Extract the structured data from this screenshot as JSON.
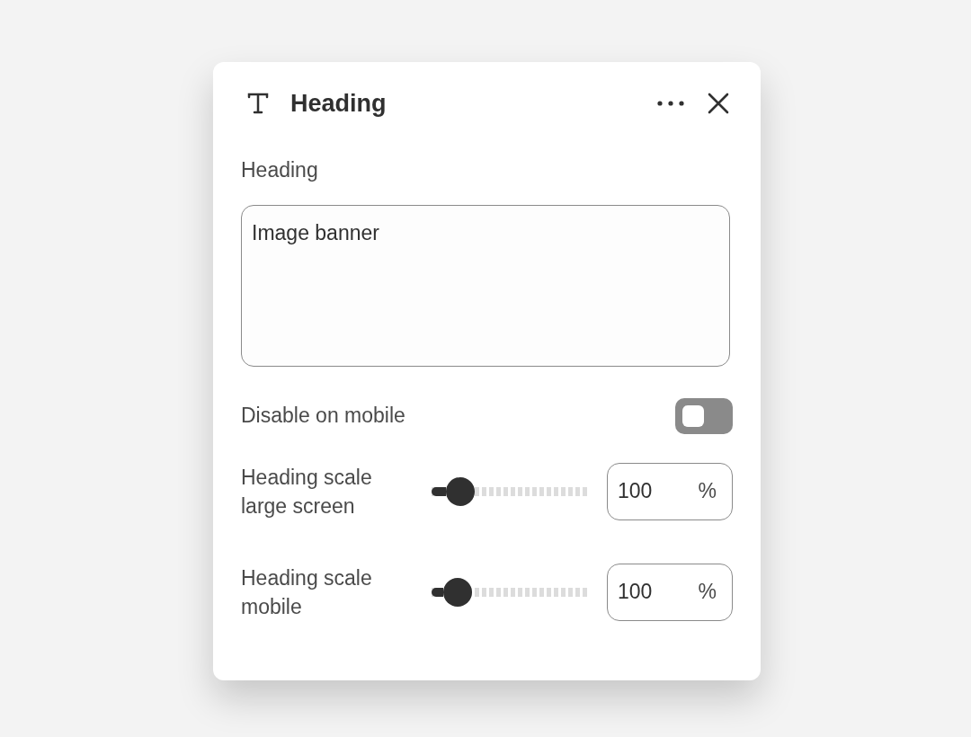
{
  "panel": {
    "title": "Heading"
  },
  "heading_field": {
    "label": "Heading",
    "value": "Image banner"
  },
  "toggle": {
    "label": "Disable on mobile",
    "on": false
  },
  "sliders": [
    {
      "label": "Heading scale large screen",
      "level": 0.18,
      "value": "100",
      "unit": "%"
    },
    {
      "label": "Heading scale mobile",
      "level": 0.165,
      "value": "100",
      "unit": "%"
    }
  ]
}
